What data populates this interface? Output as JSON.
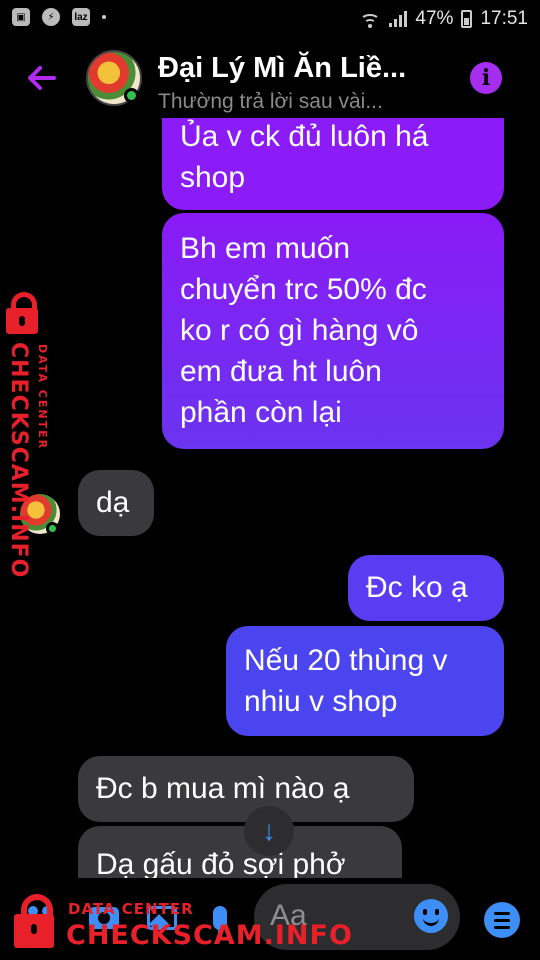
{
  "status_bar": {
    "app_icons": [
      "gallery-icon",
      "messenger-icon",
      "lazada-icon"
    ],
    "lazada_label": "laz",
    "battery": "47%",
    "time": "17:51"
  },
  "header": {
    "title": "Đại Lý Mì Ăn Liề...",
    "subtitle": "Thường trả lời sau vài...",
    "info_label": "i"
  },
  "messages": [
    {
      "direction": "outgoing",
      "lines": [
        "Ủa v ck đủ luôn há",
        "shop"
      ]
    },
    {
      "direction": "outgoing",
      "lines": [
        "Bh em muốn",
        "chuyển trc 50% đc",
        "ko r có gì hàng vô",
        "em đưa ht luôn",
        "phần còn lại"
      ]
    },
    {
      "direction": "incoming",
      "lines": [
        "dạ"
      ]
    },
    {
      "direction": "outgoing",
      "lines": [
        "Đc ko ạ"
      ]
    },
    {
      "direction": "outgoing",
      "lines": [
        "Nếu 20 thùng v",
        "nhiu v shop"
      ]
    },
    {
      "direction": "incoming",
      "lines": [
        "Đc b mua mì nào ạ"
      ]
    },
    {
      "direction": "incoming",
      "lines": [
        "Dạ gấu đỏ sợi phở"
      ]
    }
  ],
  "composer": {
    "placeholder": "Aa"
  },
  "watermark": {
    "small": "DATA CENTER",
    "big": "CHECKSCAM.INFO"
  },
  "colors": {
    "accent_purple": "#8b1cf7",
    "accent_blue": "#3e8ef7",
    "incoming_bubble": "#3a3a3c",
    "watermark_red": "#e8202a"
  }
}
